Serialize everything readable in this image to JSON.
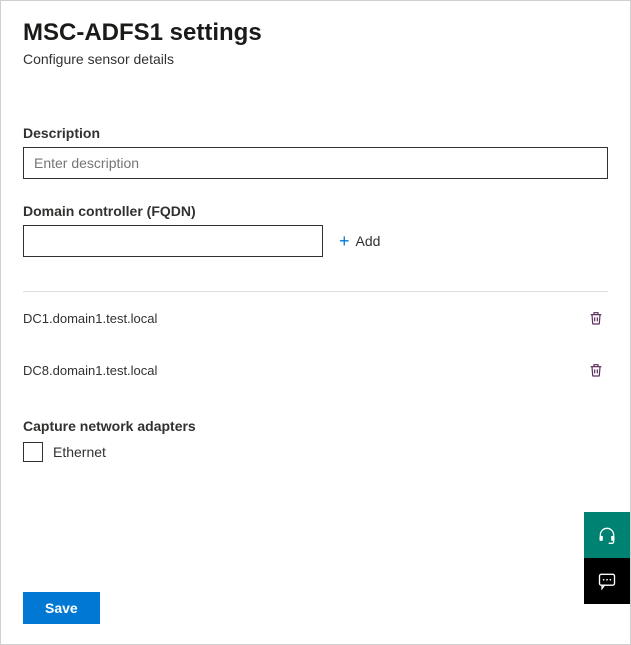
{
  "header": {
    "title": "MSC-ADFS1 settings",
    "subtitle": "Configure sensor details"
  },
  "description": {
    "label": "Description",
    "placeholder": "Enter description",
    "value": ""
  },
  "fqdn": {
    "label": "Domain controller (FQDN)",
    "value": "",
    "add_label": "Add"
  },
  "domain_controllers": [
    {
      "name": "DC1.domain1.test.local"
    },
    {
      "name": "DC8.domain1.test.local"
    }
  ],
  "adapters": {
    "label": "Capture network adapters",
    "items": [
      {
        "label": "Ethernet",
        "checked": false
      }
    ]
  },
  "actions": {
    "save": "Save"
  }
}
